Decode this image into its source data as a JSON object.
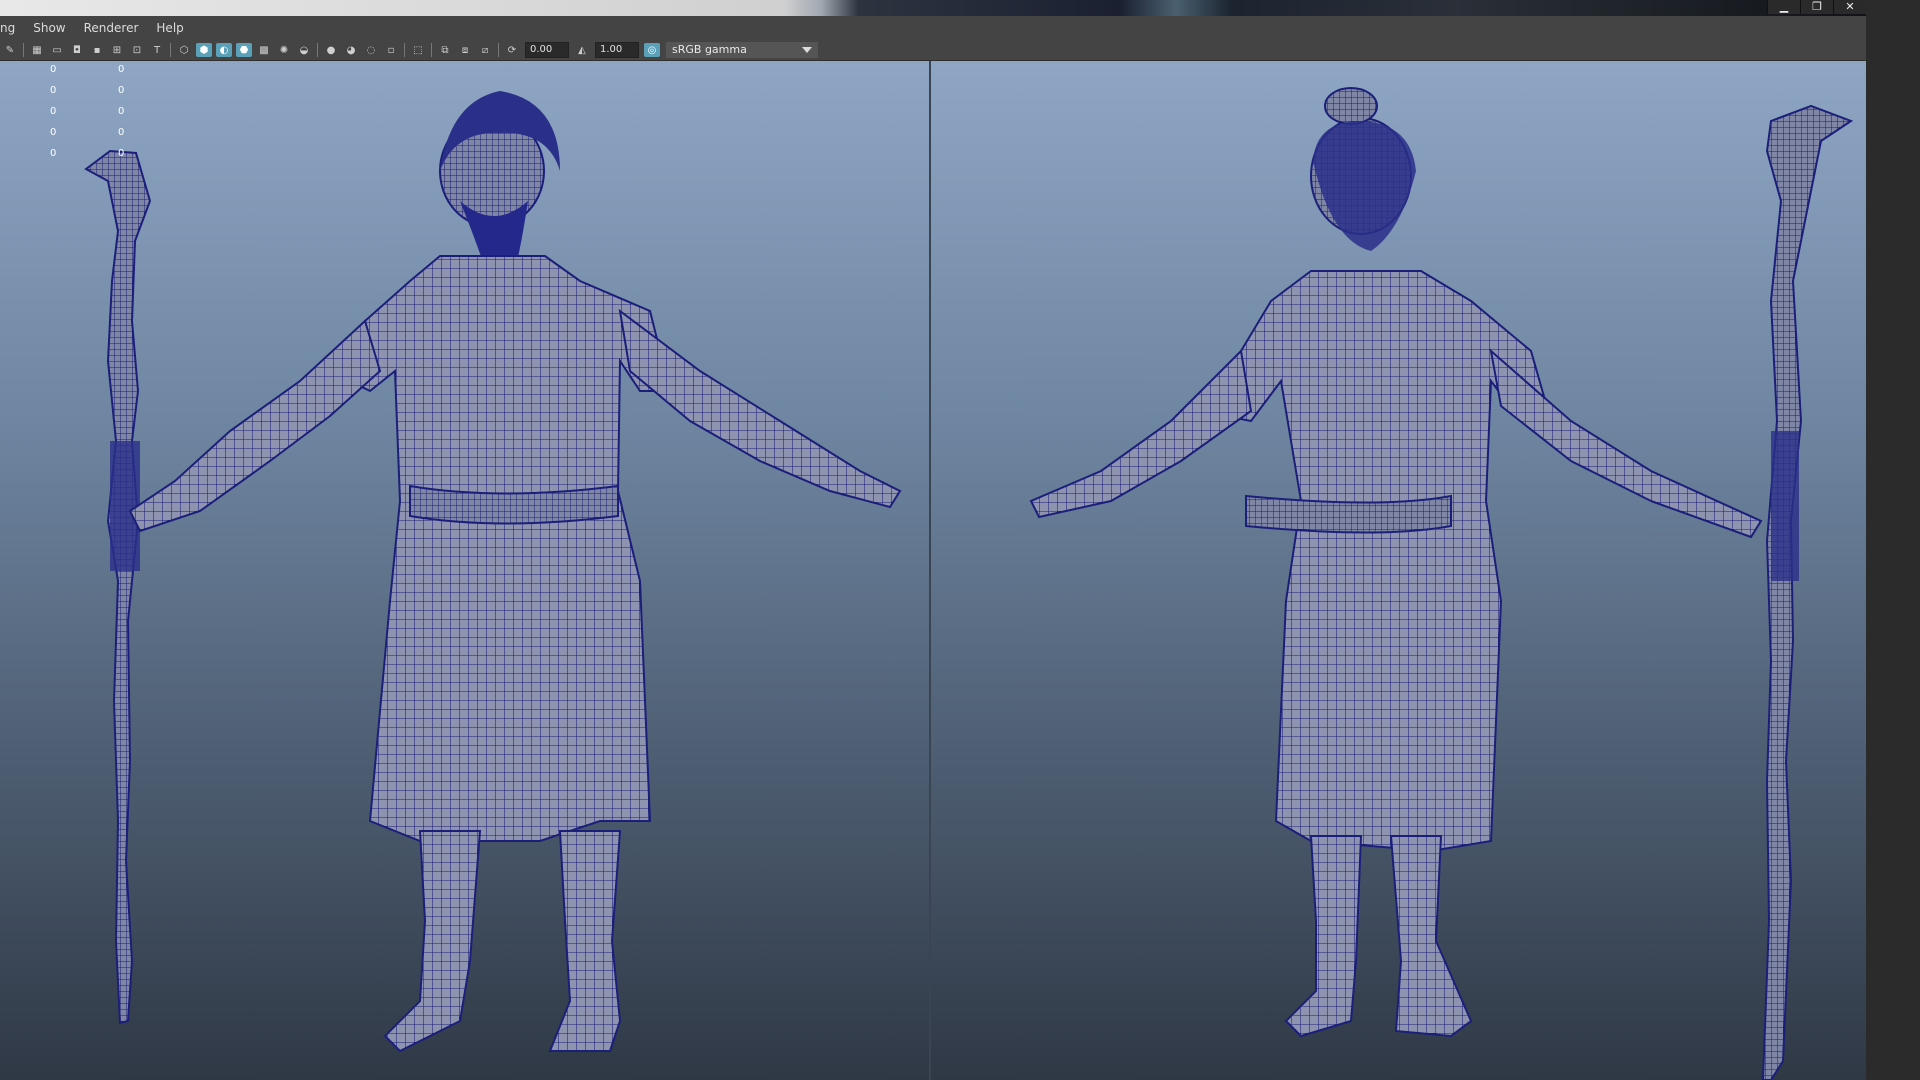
{
  "window": {
    "controls": [
      {
        "name": "minimize",
        "glyph": "▁"
      },
      {
        "name": "maximize",
        "glyph": "❐"
      },
      {
        "name": "close",
        "glyph": "✕"
      }
    ]
  },
  "menubar": {
    "items": [
      "ng",
      "Show",
      "Renderer",
      "Help"
    ]
  },
  "toolbar": {
    "exposure_value": "0.00",
    "gamma_value": "1.00",
    "color_space": "sRGB gamma"
  },
  "hud": {
    "values": [
      "0",
      "0",
      "0",
      "0",
      "0",
      "0",
      "0",
      "0",
      "0",
      "0"
    ]
  },
  "colors": {
    "wire": "#1c1f7a",
    "mesh_fill": "#8e94b0",
    "accent": "#5aa0b8"
  }
}
